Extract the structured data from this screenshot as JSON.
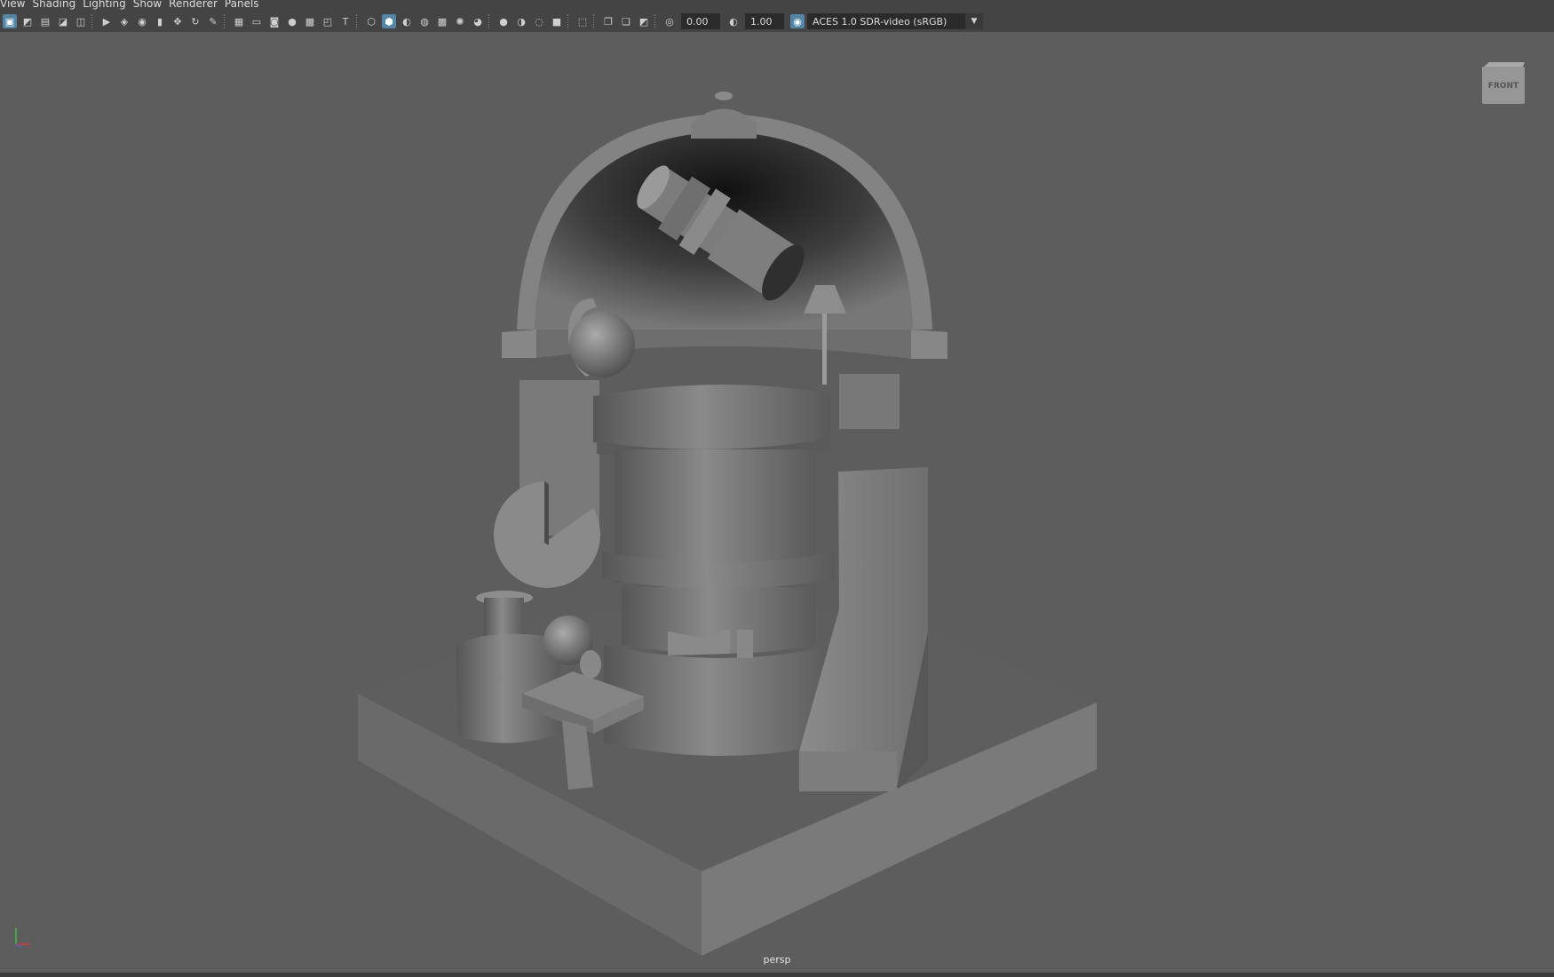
{
  "menu": [
    "View",
    "Shading",
    "Lighting",
    "Show",
    "Renderer",
    "Panels"
  ],
  "toolbar": {
    "exposure_value": "0.00",
    "gamma_value": "1.00",
    "color_space": "ACES 1.0 SDR-video (sRGB)",
    "icons": [
      "select-camera-icon",
      "camera-attributes-icon",
      "bookmarks-icon",
      "image-plane-icon",
      "2d-pan-zoom-icon",
      "grease-pencil-icon",
      "grid-icon",
      "film-gate-icon",
      "resolution-gate-icon",
      "gate-mask-icon",
      "field-chart-icon",
      "safe-action-icon",
      "safe-title-icon",
      "wireframe-icon",
      "smooth-shade-icon",
      "use-default-material-icon",
      "wireframe-on-shaded-icon",
      "x-ray-icon",
      "textured-icon",
      "use-all-lights-icon",
      "shadows-icon",
      "screen-space-ao-icon",
      "motion-blur-icon",
      "multisample-aa-icon",
      "depth-of-field-icon",
      "isolate-select-icon",
      "xray-joints-icon",
      "xray-active-icon",
      "exposure-icon",
      "gamma-icon",
      "color-management-icon"
    ],
    "colors": {
      "active": "#5285a6"
    }
  },
  "viewport": {
    "camera_name": "persp",
    "viewcube_label": "FRONT",
    "background": "#5d5d5d"
  }
}
